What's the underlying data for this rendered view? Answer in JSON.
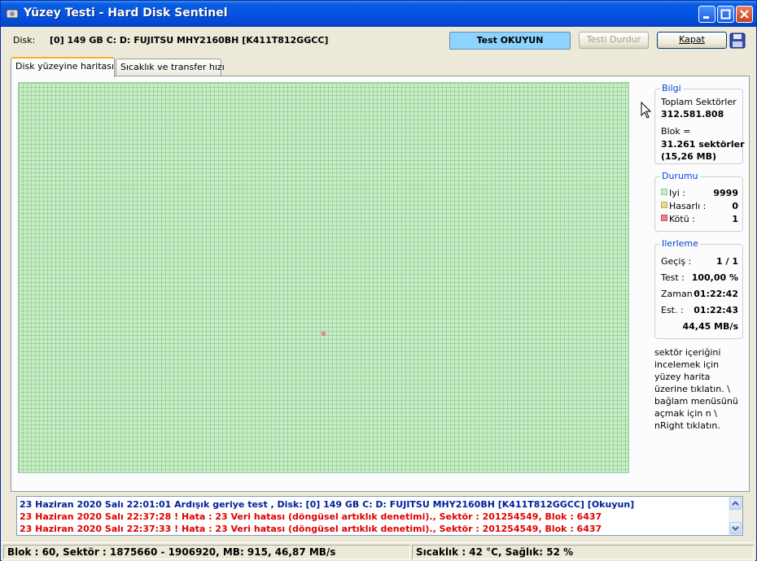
{
  "window": {
    "title": "Yüzey Testi  - Hard Disk Sentinel"
  },
  "toolbar": {
    "disk_label": "Disk:",
    "disk_name": "[0] 149 GB C: D: FUJITSU MHY2160BH [K411T812GGCC]",
    "status_label": "Test OKUYUN",
    "stop_label": "Testi  Durdur",
    "close_label": "Kapat"
  },
  "tabs": [
    {
      "label": "Disk yüzeyine haritası",
      "active": true
    },
    {
      "label": "Sıcaklık ve transfer hızı",
      "active": false
    }
  ],
  "info": {
    "title": "Bilgi",
    "total_label": "Toplam Sektörler",
    "total_value": "312.581.808",
    "block_label": "Blok  =",
    "block_value": "31.261 sektörler",
    "block_size": "(15,26 MB)"
  },
  "status": {
    "title": "Durumu",
    "good_label": "Iyi :",
    "good_value": "9999",
    "damaged_label": "Hasarlı :",
    "damaged_value": "0",
    "bad_label": "Kötü :",
    "bad_value": "1",
    "colors": {
      "good": "#c8eec8",
      "damaged": "#e8d890",
      "bad": "#f08090"
    }
  },
  "progress": {
    "title": "Ilerleme",
    "pass_label": "Geçiş :",
    "pass_value": "1 / 1",
    "test_label": "Test :",
    "test_value": "100,00 %",
    "time_label": "Zaman :",
    "time_value": "01:22:42",
    "est_label": "Est. :",
    "est_value": "01:22:43",
    "speed_value": "44,45 MB/s"
  },
  "help_text": "sektör içeriğini incelemek için yüzey harita üzerine tıklatın. \\ bağlam menüsünü açmak için n \\ nRight tıklatın.",
  "log": [
    "23 Haziran 2020 Salı  22:01:01   Ardışık geriye test , Disk:  [0] 149 GB C: D: FUJITSU MHY2160BH [K411T812GGCC] [Okuyun]",
    "23 Haziran 2020 Salı  22:37:28 ! Hata : 23 Veri hatası (döngüsel artıklık denetimi)., Sektör : 201254549, Blok : 6437",
    "23 Haziran 2020 Salı  22:37:33 ! Hata : 23 Veri hatası (döngüsel artıklık denetimi)., Sektör : 201254549, Blok : 6437"
  ],
  "statusbar": {
    "left": "Blok : 60, Sektör : 1875660 - 1906920, MB: 915, 46,87 MB/s",
    "right": "Sıcaklık : 42  °C,  Sağlık:  52 %"
  }
}
